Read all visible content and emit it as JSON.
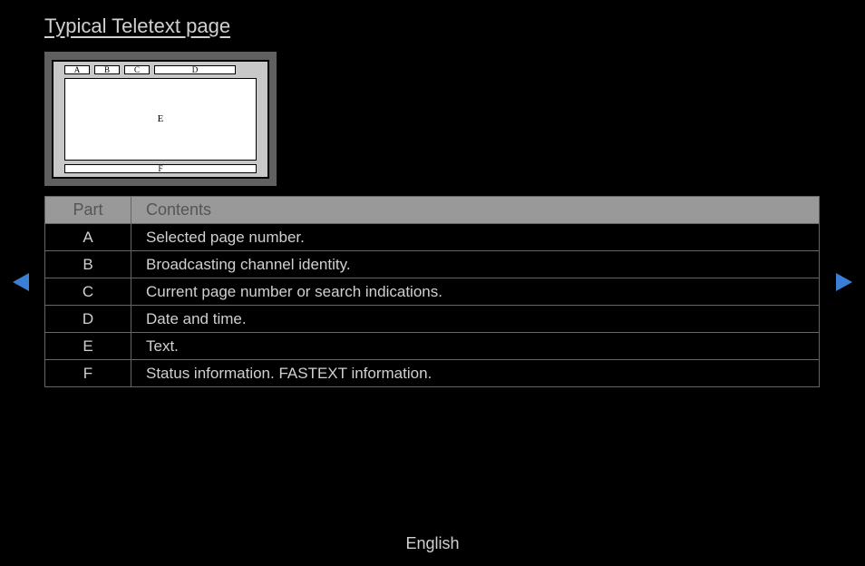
{
  "title": "Typical Teletext page",
  "diagram": {
    "labels": {
      "a": "A",
      "b": "B",
      "c": "C",
      "d": "D",
      "e": "E",
      "f": "F"
    }
  },
  "table": {
    "headers": {
      "part": "Part",
      "contents": "Contents"
    },
    "rows": [
      {
        "part": "A",
        "contents": "Selected page number."
      },
      {
        "part": "B",
        "contents": "Broadcasting channel identity."
      },
      {
        "part": "C",
        "contents": "Current page number or search indications."
      },
      {
        "part": "D",
        "contents": "Date and time."
      },
      {
        "part": "E",
        "contents": "Text."
      },
      {
        "part": "F",
        "contents": "Status information. FASTEXT information."
      }
    ]
  },
  "navigation": {
    "prev_color": "#3a7ed6",
    "next_color": "#3a7ed6"
  },
  "footer": {
    "language": "English"
  }
}
